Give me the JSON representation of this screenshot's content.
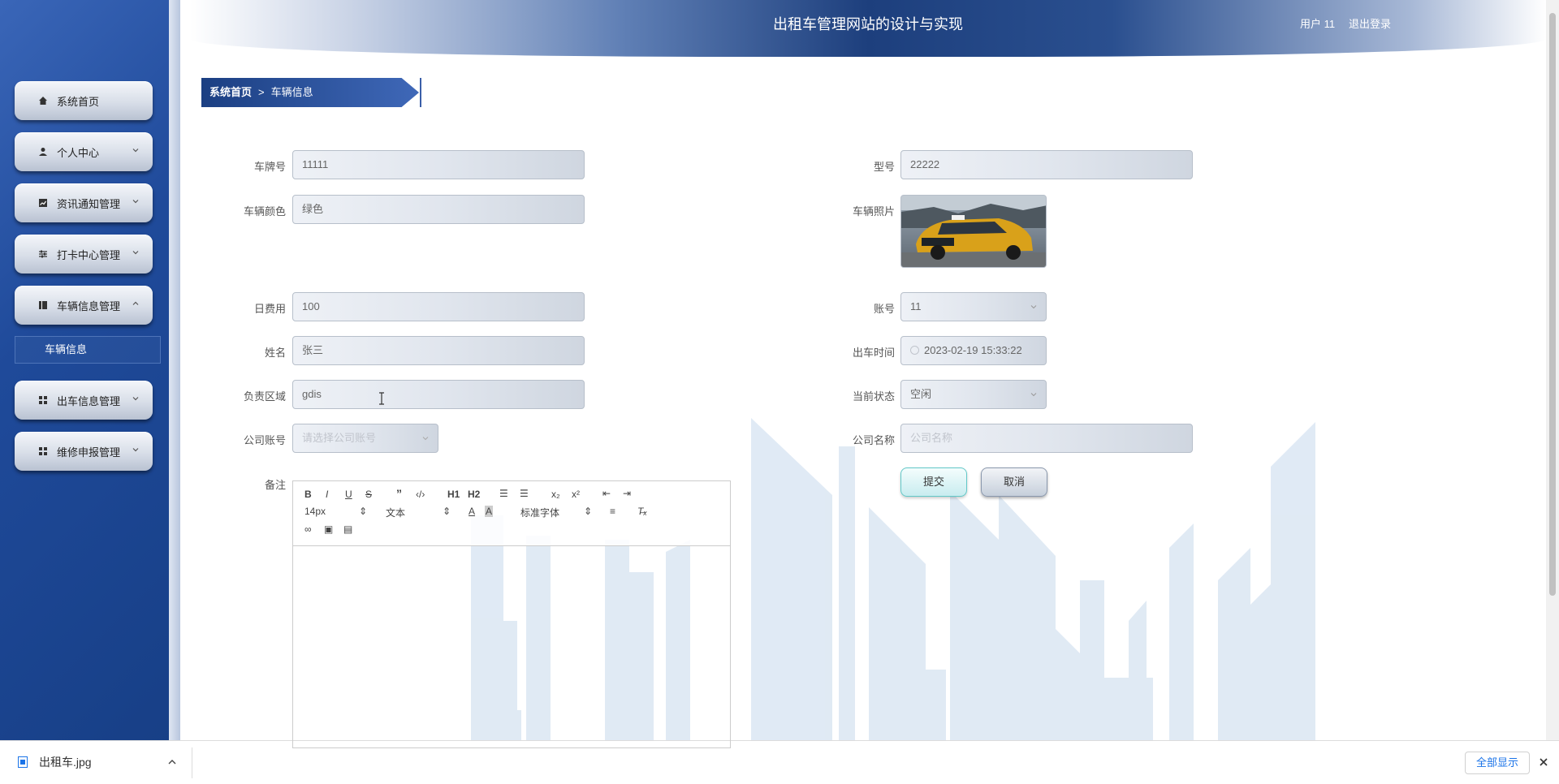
{
  "header": {
    "title": "出租车管理网站的设计与实现",
    "user": "用户 11",
    "logout": "退出登录"
  },
  "sidebar": {
    "items": [
      {
        "label": "系统首页",
        "icon": "home-icon"
      },
      {
        "label": "个人中心",
        "icon": "user-icon"
      },
      {
        "label": "资讯通知管理",
        "icon": "chart-icon"
      },
      {
        "label": "打卡中心管理",
        "icon": "sliders-icon"
      },
      {
        "label": "车辆信息管理",
        "icon": "book-icon"
      },
      {
        "label": "出车信息管理",
        "icon": "grid-icon"
      },
      {
        "label": "维修申报管理",
        "icon": "grid-icon"
      }
    ],
    "submenu": "车辆信息"
  },
  "breadcrumb": {
    "home": "系统首页",
    "separator": ">",
    "current": "车辆信息"
  },
  "form": {
    "plate_label": "车牌号",
    "plate_value": "11111",
    "model_label": "型号",
    "model_value": "22222",
    "color_label": "车辆颜色",
    "color_value": "绿色",
    "photo_label": "车辆照片",
    "daily_fee_label": "日费用",
    "daily_fee_value": "100",
    "account_label": "账号",
    "account_value": "11",
    "name_label": "姓名",
    "name_value": "张三",
    "depart_time_label": "出车时间",
    "depart_time_value": "2023-02-19 15:33:22",
    "area_label": "负责区域",
    "area_value": "gdis",
    "status_label": "当前状态",
    "status_value": "空闲",
    "company_account_label": "公司账号",
    "company_account_placeholder": "请选择公司账号",
    "company_name_label": "公司名称",
    "company_name_placeholder": "公司名称",
    "remark_label": "备注"
  },
  "editor": {
    "font_size": "14px",
    "format": "文本",
    "font_family": "标准字体",
    "h1": "H1",
    "h2": "H2"
  },
  "buttons": {
    "submit": "提交",
    "cancel": "取消"
  },
  "download": {
    "filename": "出租车.jpg",
    "show_all": "全部显示"
  },
  "colors": {
    "sidebar": "#1f4a9a",
    "header": "#1d3f7d",
    "accent": "#62c8c8"
  }
}
